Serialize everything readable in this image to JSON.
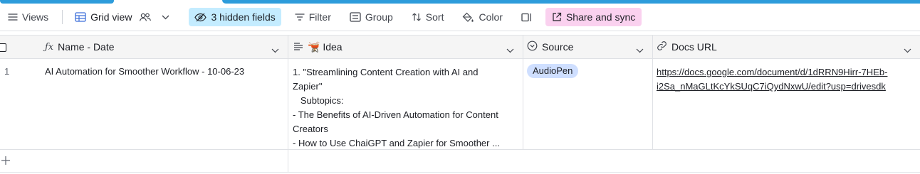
{
  "toolbar": {
    "views_label": "Views",
    "grid_view_label": "Grid view",
    "hidden_fields_label": "3 hidden fields",
    "filter_label": "Filter",
    "group_label": "Group",
    "sort_label": "Sort",
    "color_label": "Color",
    "share_label": "Share and sync"
  },
  "columns": [
    {
      "label": "Name - Date",
      "icon": "formula-icon"
    },
    {
      "label": "🫕 Idea",
      "icon": "long-text-icon"
    },
    {
      "label": "Source",
      "icon": "single-select-icon"
    },
    {
      "label": "Docs URL",
      "icon": "link-icon"
    }
  ],
  "rows": [
    {
      "number": "1",
      "name": "AI Automation for Smoother Workflow - 10-06-23",
      "idea_lines": [
        "1. \"Streamlining Content Creation with AI and",
        "Zapier\"",
        "   Subtopics:",
        "- The Benefits of AI-Driven Automation for Content",
        "Creators",
        "- How to Use ChaiGPT and Zapier for Smoother ..."
      ],
      "source": "AudioPen",
      "url_lines": [
        "https://docs.google.com/document/d/1dRRN9Hirr-7HEb-",
        "i2Sa_nMaGLtKcYkSUqC7iQydNxwU/edit?usp=drivesdk"
      ]
    }
  ],
  "colors": {
    "accent": "#2d9cdb",
    "hidden_fields_bg": "#c4ecff",
    "share_bg": "#fad1ef",
    "source_pill_bg": "#cfdfff"
  }
}
